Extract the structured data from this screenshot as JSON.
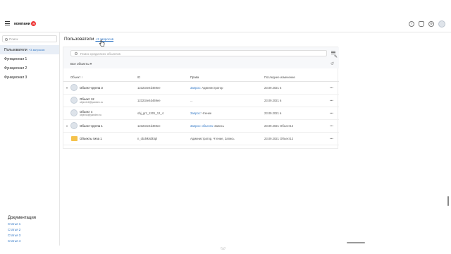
{
  "header": {
    "logo_text": "компани",
    "logo_badge": "Я",
    "icons": [
      "help-icon",
      "bell-icon",
      "settings-icon",
      "avatar"
    ]
  },
  "sidebar": {
    "search_placeholder": "Поиск",
    "items": [
      {
        "label": "Пользователи",
        "extra": "+3 запросов",
        "active": true
      },
      {
        "label": "Функционал 1",
        "extra": "",
        "active": false
      },
      {
        "label": "Функционал 2",
        "extra": "",
        "active": false
      },
      {
        "label": "Функционал 3",
        "extra": "",
        "active": false
      }
    ],
    "docs": {
      "heading": "Документация",
      "links": [
        "Статья 1",
        "Статья 2",
        "Статья 3",
        "Статья 4"
      ]
    }
  },
  "main": {
    "title": "Пользователи",
    "title_link": "+3 запросов",
    "search_placeholder": "Поиск среди всех объектов",
    "filter_label": "Все объекты",
    "columns": [
      "Объект",
      "ID",
      "Права",
      "Последнее изменение"
    ],
    "sort_indicator": "↑",
    "rows": [
      {
        "expand": "▾",
        "kind": "avatar",
        "name": "Объект-группа 3",
        "sub": "",
        "id": "123234e4d469ee",
        "rights": "Запрос: Администратор",
        "rights_style": "mixed",
        "changed": "23.09.2021 в",
        "menu": "•••"
      },
      {
        "expand": "",
        "kind": "avatar",
        "name": "Объект 12",
        "sub": "object12@yandex.ru",
        "id": "123234e4d469ee",
        "rights": "...",
        "rights_style": "gray",
        "changed": "23.09.2021 в",
        "menu": "•••"
      },
      {
        "expand": "",
        "kind": "avatar",
        "name": "Объект 4",
        "sub": "object4@yandex.ru",
        "id": "obj_grz_1301_12_4",
        "rights": "Запрос: Чтение",
        "rights_style": "mixed",
        "changed": "23.09.2021 в",
        "menu": "•••"
      },
      {
        "expand": "▾",
        "kind": "avatar",
        "name": "Объект-группа 1",
        "sub": "",
        "id": "123234e4d469ee",
        "rights": "Запрос: объекта: Запись",
        "rights_style": "mixed",
        "changed": "23.09.2021 Объект12",
        "menu": "•••"
      },
      {
        "expand": "",
        "kind": "folder",
        "name": "Объекты типа 1",
        "sub": "",
        "id": "n_obdsktsbbtpl",
        "rights": "Администратор, Чтение, Запись",
        "rights_style": "gray",
        "changed": "23.09.2021 Объект12",
        "menu": "•••"
      }
    ]
  },
  "footer": {
    "mark": "\\\\\\//"
  },
  "colors": {
    "accent": "#2b73c4",
    "active_bg": "#e8eef6",
    "folder": "#f5c24b",
    "logo_badge": "#e33333"
  }
}
